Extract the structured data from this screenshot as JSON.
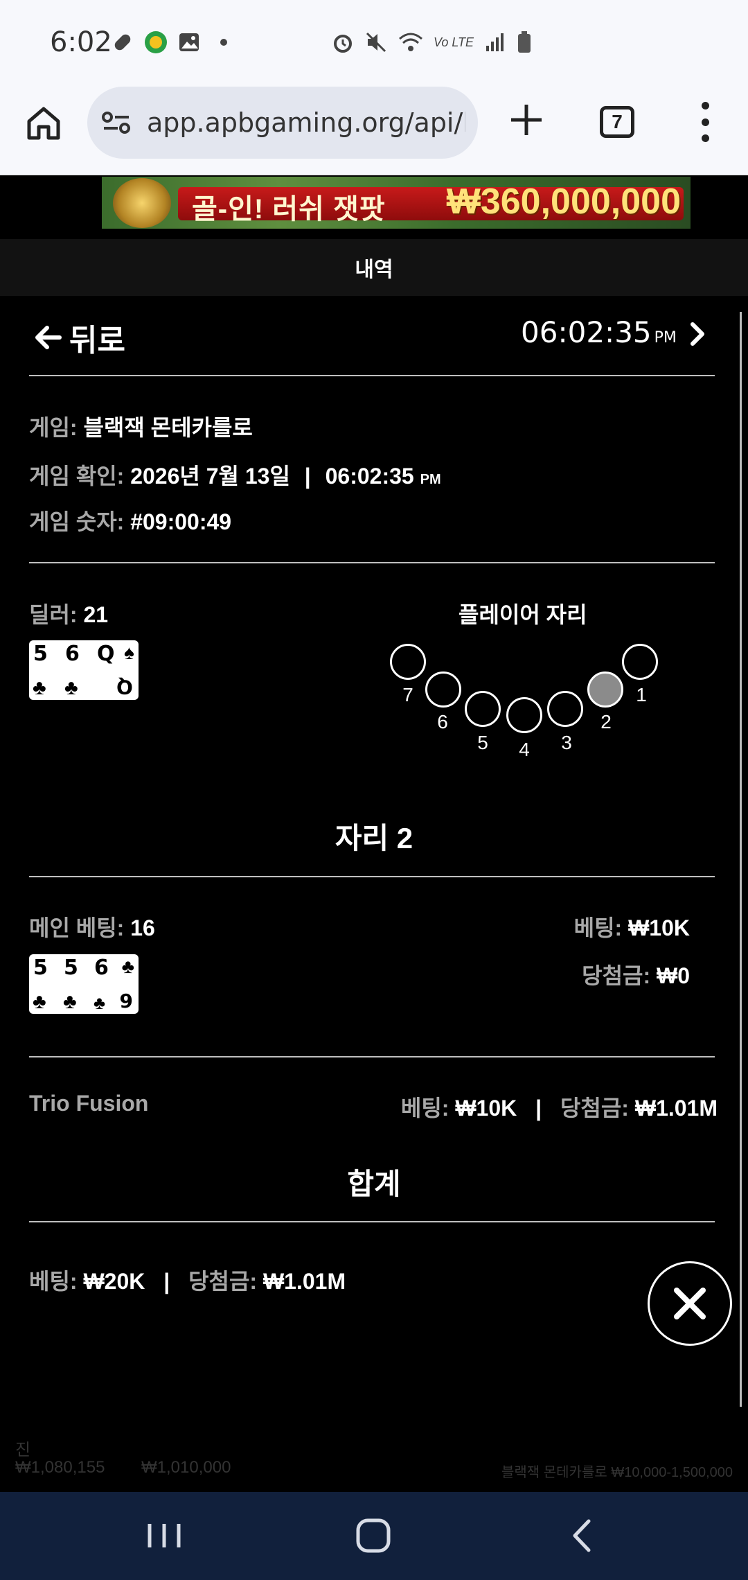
{
  "status_bar": {
    "time": "6:02",
    "lte_label": "Vo LTE"
  },
  "browser": {
    "url": "app.apbgaming.org/api/lau",
    "tab_count": "7"
  },
  "banner": {
    "text": "골-인! 러쉬 잿팟",
    "amount": "₩360,000,000"
  },
  "header": {
    "title": "내역"
  },
  "nav": {
    "back_label": "뒤로",
    "time": "06:02:35",
    "time_suffix": "PM"
  },
  "game_info": {
    "game_label": "게임:",
    "game_value": "블랙잭 몬테카를로",
    "date_label": "게임 확인:",
    "date_value": "2026년 7월 13일",
    "date_sep": "|",
    "date_time": "06:02:35",
    "date_time_suffix": "PM",
    "number_label": "게임 숫자:",
    "number_value": "#09:00:49"
  },
  "dealer": {
    "label": "딜러:",
    "value": "21",
    "cards": [
      {
        "rank": "5",
        "suit": "♣",
        "color": "#000000"
      },
      {
        "rank": "6",
        "suit": "♣",
        "color": "#000000"
      },
      {
        "rank": "Q",
        "suit": "♠",
        "color": "#000000"
      }
    ]
  },
  "seats": {
    "title": "플레이어 자리",
    "numbers": [
      "1",
      "2",
      "3",
      "4",
      "5",
      "6",
      "7"
    ],
    "active": "2"
  },
  "seat_detail": {
    "title": "자리 2",
    "main_bet_label": "메인 베팅:",
    "main_bet_value": "16",
    "bet_label": "베팅:",
    "bet_value": "₩10K",
    "win_label": "당첨금:",
    "win_value": "₩0",
    "cards": [
      {
        "rank": "5",
        "suit": "♣"
      },
      {
        "rank": "5",
        "suit": "♣"
      },
      {
        "rank": "6",
        "suit": "♣",
        "bottom_rank": "9"
      }
    ]
  },
  "side_bet": {
    "name": "Trio Fusion",
    "bet_label": "베팅:",
    "bet_value": "₩10K",
    "sep": "|",
    "win_label": "당첨금:",
    "win_value": "₩1.01M"
  },
  "total": {
    "title": "합계",
    "bet_label": "베팅:",
    "bet_value": "₩20K",
    "sep": "|",
    "win_label": "당첨금:",
    "win_value": "₩1.01M"
  },
  "footer": {
    "label": "진",
    "balance": "₩1,080,155",
    "total_win": "₩1,010,000",
    "table_info": "블랙잭 몬테카를로 ₩10,000-1,500,000"
  },
  "colors": {
    "status_bg": "#f7f8fc",
    "navbar_bg": "#11203c",
    "active_seat": "#8b8b8b"
  }
}
